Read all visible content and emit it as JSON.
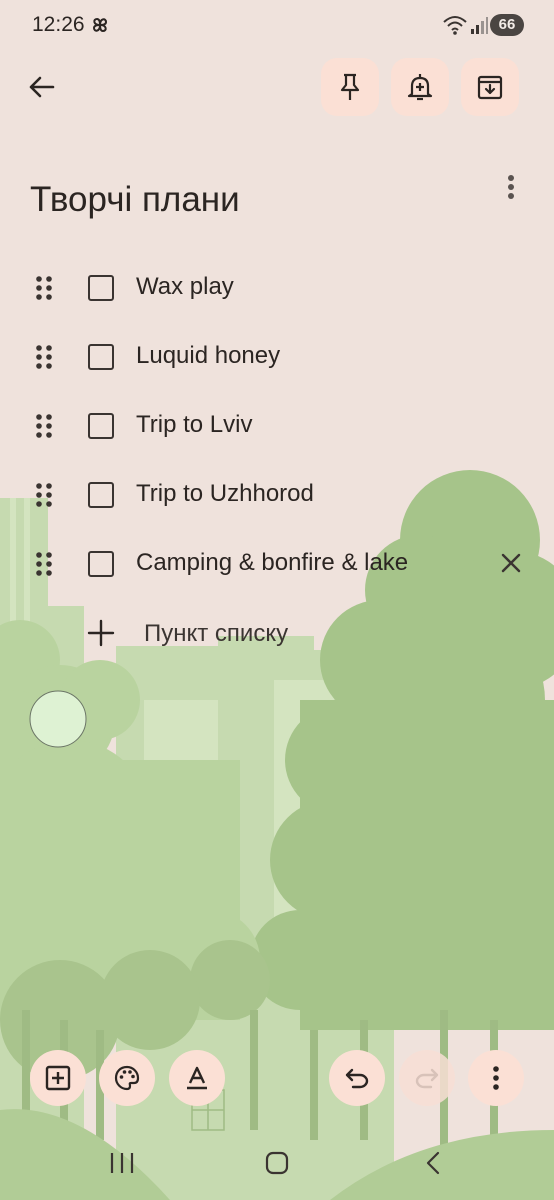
{
  "status_bar": {
    "time": "12:26",
    "battery": "66",
    "icons": [
      "fan-icon",
      "wifi-icon",
      "signal-icon"
    ]
  },
  "top_bar": {
    "icons": [
      "back-arrow-icon",
      "pin-icon",
      "add-reminder-icon",
      "archive-icon"
    ]
  },
  "note": {
    "title": "Творчі плани",
    "items": [
      {
        "text": "Wax play",
        "checked": false
      },
      {
        "text": "Luquid honey",
        "checked": false
      },
      {
        "text": "Trip to Lviv",
        "checked": false
      },
      {
        "text": "Trip to Uzhhorod",
        "checked": false
      },
      {
        "text": "Camping & bonfire & lake",
        "checked": false
      }
    ],
    "add_item_label": "Пункт списку"
  },
  "toolbar": {
    "icons": [
      "add-box-icon",
      "palette-icon",
      "text-format-icon",
      "undo-icon",
      "redo-icon",
      "more-vert-icon"
    ]
  },
  "nav_bar": {
    "icons": [
      "recent-apps-icon",
      "home-icon",
      "back-icon"
    ]
  },
  "colors": {
    "background": "#efe2dc",
    "button_fill": "#fbe0d5",
    "text": "#2b2522",
    "foliage_light": "#c5d9ac",
    "foliage_mid": "#a9c68d",
    "foliage_dark": "#8faa73"
  }
}
